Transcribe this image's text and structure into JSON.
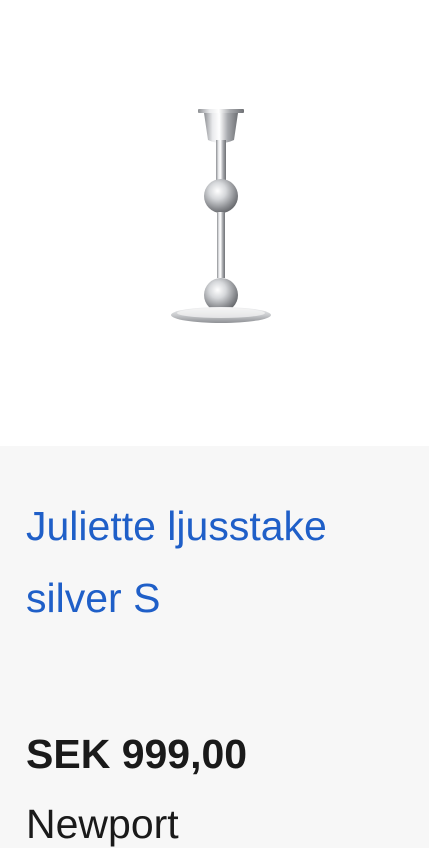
{
  "product": {
    "image_alt": "Juliette ljusstake silver S",
    "title": "Juliette ljusstake silver S",
    "price": "SEK 999,00",
    "brand": "Newport"
  },
  "colors": {
    "title_link": "#1f5fc8",
    "text": "#1a1a1a",
    "info_background": "#f7f7f7",
    "image_background": "#ffffff"
  }
}
